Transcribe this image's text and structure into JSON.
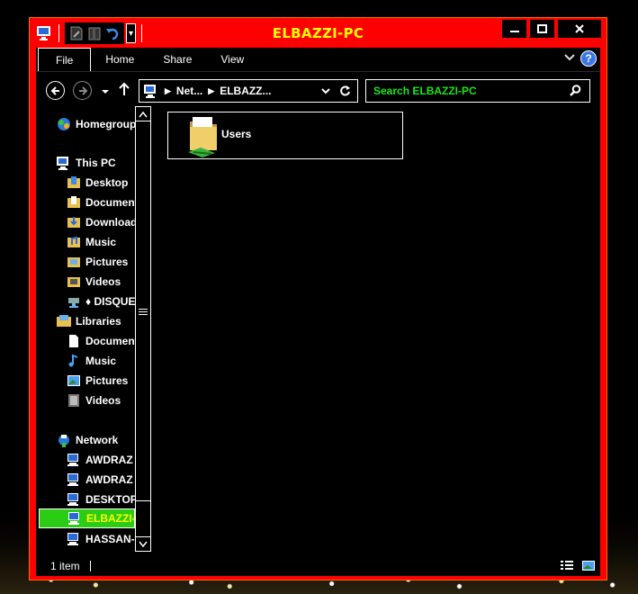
{
  "window": {
    "title": "ELBAZZI-PC"
  },
  "ribbon": {
    "tabs": [
      "File",
      "Home",
      "Share",
      "View"
    ]
  },
  "address": {
    "crumb1": "Net...",
    "crumb2": "ELBAZZ..."
  },
  "search": {
    "placeholder": "Search ELBAZZI-PC"
  },
  "nav": {
    "homegroup": "Homegroup",
    "this_pc": "This PC",
    "this_pc_items": [
      "Desktop",
      "Documents",
      "Downloads",
      "Music",
      "Pictures",
      "Videos",
      "♦ DISQUE"
    ],
    "libraries": "Libraries",
    "library_items": [
      "Documents",
      "Music",
      "Pictures",
      "Videos"
    ],
    "network": "Network",
    "network_items": [
      "AWDRAZ",
      "AWDRAZ",
      "DESKTOP",
      "ELBAZZI-PC",
      "HASSAN-"
    ]
  },
  "content": {
    "items": [
      {
        "label": "Users"
      }
    ]
  },
  "status": {
    "count": "1 item"
  },
  "colors": {
    "frame": "#ff0000",
    "title_text": "#ffff00",
    "search_text": "#19e619",
    "selection": "#2bcc14"
  }
}
